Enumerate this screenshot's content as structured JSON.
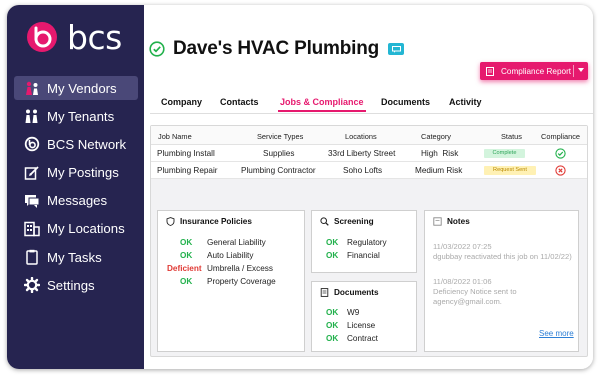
{
  "brand": {
    "name": "bcs",
    "accent": "#e6196e",
    "sidebar_bg": "#262450"
  },
  "sidebar": {
    "items": [
      {
        "label": "My Vendors",
        "icon": "vendors-icon",
        "active": true
      },
      {
        "label": "My Tenants",
        "icon": "tenants-icon"
      },
      {
        "label": "BCS Network",
        "icon": "network-icon"
      },
      {
        "label": "My Postings",
        "icon": "postings-icon"
      },
      {
        "label": "Messages",
        "icon": "messages-icon"
      },
      {
        "label": "My Locations",
        "icon": "locations-icon"
      },
      {
        "label": "My Tasks",
        "icon": "tasks-icon"
      },
      {
        "label": "Settings",
        "icon": "gear-icon"
      }
    ]
  },
  "header": {
    "title": "Dave's HVAC Plumbing",
    "compliance_button": "Compliance Report"
  },
  "tabs": [
    {
      "label": "Company"
    },
    {
      "label": "Contacts"
    },
    {
      "label": "Jobs & Compliance",
      "active": true
    },
    {
      "label": "Documents"
    },
    {
      "label": "Activity"
    }
  ],
  "jobs_table": {
    "columns": [
      "Job Name",
      "Service Types",
      "Locations",
      "Category",
      "Status",
      "Compliance"
    ],
    "rows": [
      {
        "job": "Plumbing Install",
        "service": "Supplies",
        "location": "33rd Liberty Street",
        "category": "High  Risk",
        "status": "Complete",
        "compliance": "check-icon"
      },
      {
        "job": "Plumbing Repair",
        "service": "Plumbing Contractor",
        "location": "Soho Lofts",
        "category": "Medium Risk",
        "status": "Request Sent",
        "compliance": "x-icon"
      }
    ]
  },
  "insurance": {
    "title": "Insurance Policies",
    "items": [
      {
        "status": "OK",
        "name": "General Liability"
      },
      {
        "status": "OK",
        "name": "Auto Liability"
      },
      {
        "status": "Deficient",
        "name": "Umbrella / Excess"
      },
      {
        "status": "OK",
        "name": "Property Coverage"
      }
    ]
  },
  "screening": {
    "title": "Screening",
    "items": [
      {
        "status": "OK",
        "name": "Regulatory"
      },
      {
        "status": "OK",
        "name": "Financial"
      }
    ]
  },
  "documents": {
    "title": "Documents",
    "items": [
      {
        "status": "OK",
        "name": "W9"
      },
      {
        "status": "OK",
        "name": "License"
      },
      {
        "status": "OK",
        "name": "Contract"
      }
    ]
  },
  "notes": {
    "title": "Notes",
    "entries": [
      {
        "date": "11/03/2022 07:25",
        "text": "dgubbay reactivated this job on 11/02/22)"
      },
      {
        "date": "11/08/2022 01:06",
        "text": "Deficiency Notice sent to agency@gmail.com."
      }
    ],
    "see_more": "See more"
  }
}
